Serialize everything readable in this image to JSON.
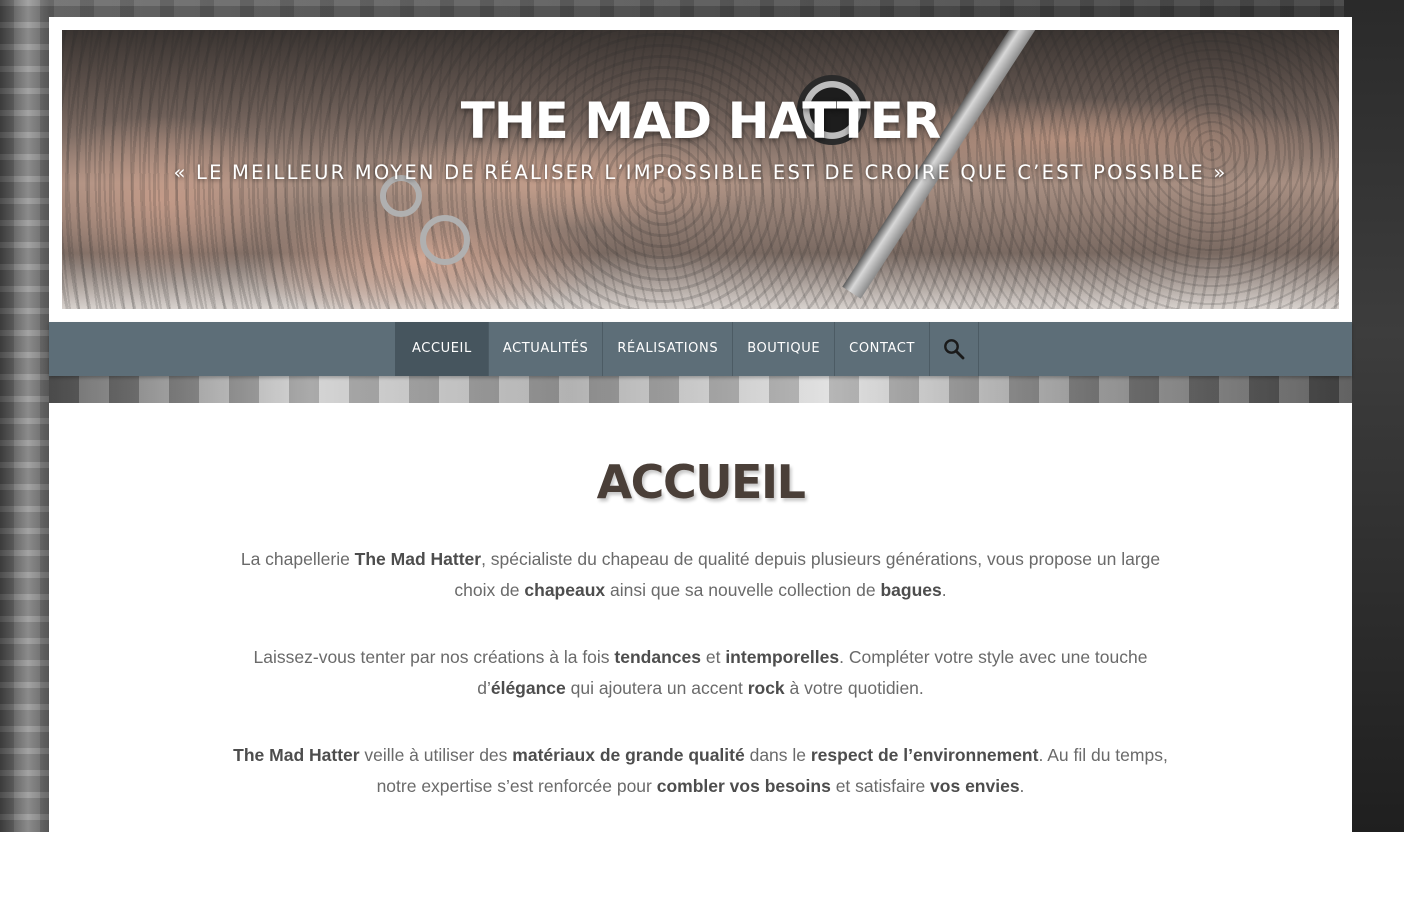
{
  "site": {
    "title": "THE MAD HATTER",
    "tagline": "« LE MEILLEUR MOYEN DE RÉALISER L’IMPOSSIBLE EST DE CROIRE QUE C’EST POSSIBLE »"
  },
  "nav": {
    "items": [
      {
        "label": "ACCUEIL",
        "active": true
      },
      {
        "label": "ACTUALITÉS",
        "active": false
      },
      {
        "label": "RÉALISATIONS",
        "active": false
      },
      {
        "label": "BOUTIQUE",
        "active": false
      },
      {
        "label": "CONTACT",
        "active": false
      }
    ],
    "search_icon": "search-icon"
  },
  "main": {
    "page_title": "ACCUEIL",
    "p1": {
      "t1": "La chapellerie ",
      "b1": "The Mad Hatter",
      "t2": ", spécialiste du chapeau de qualité depuis plusieurs générations, vous propose un large choix de ",
      "b2": "chapeaux",
      "t3": " ainsi que sa nouvelle collection de ",
      "b3": "bagues",
      "t4": "."
    },
    "p2": {
      "t1": "Laissez-vous tenter par nos créations à la fois ",
      "b1": "tendances",
      "t2": " et ",
      "b2": "intemporelles",
      "t3": ". Compléter votre style avec une touche d’",
      "b3": "élégance",
      "t4": " qui ajoutera un accent ",
      "b4": "rock",
      "t5": " à votre quotidien."
    },
    "p3": {
      "b1": "The Mad Hatter",
      "t1": " veille à utiliser des ",
      "b2": "matériaux de grande qualité",
      "t2": " dans le ",
      "b3": "respect de l’environnement",
      "t3": ". Au fil du temps, notre expertise s’est renforcée pour ",
      "b4": "combler vos besoins",
      "t4": " et satisfaire ",
      "b5": "vos envies",
      "t5": "."
    }
  },
  "colors": {
    "nav_bg": "#5d6e78",
    "nav_active_bg": "#46555e",
    "title_color": "#4a3f38",
    "body_text": "#6a6a6a"
  }
}
